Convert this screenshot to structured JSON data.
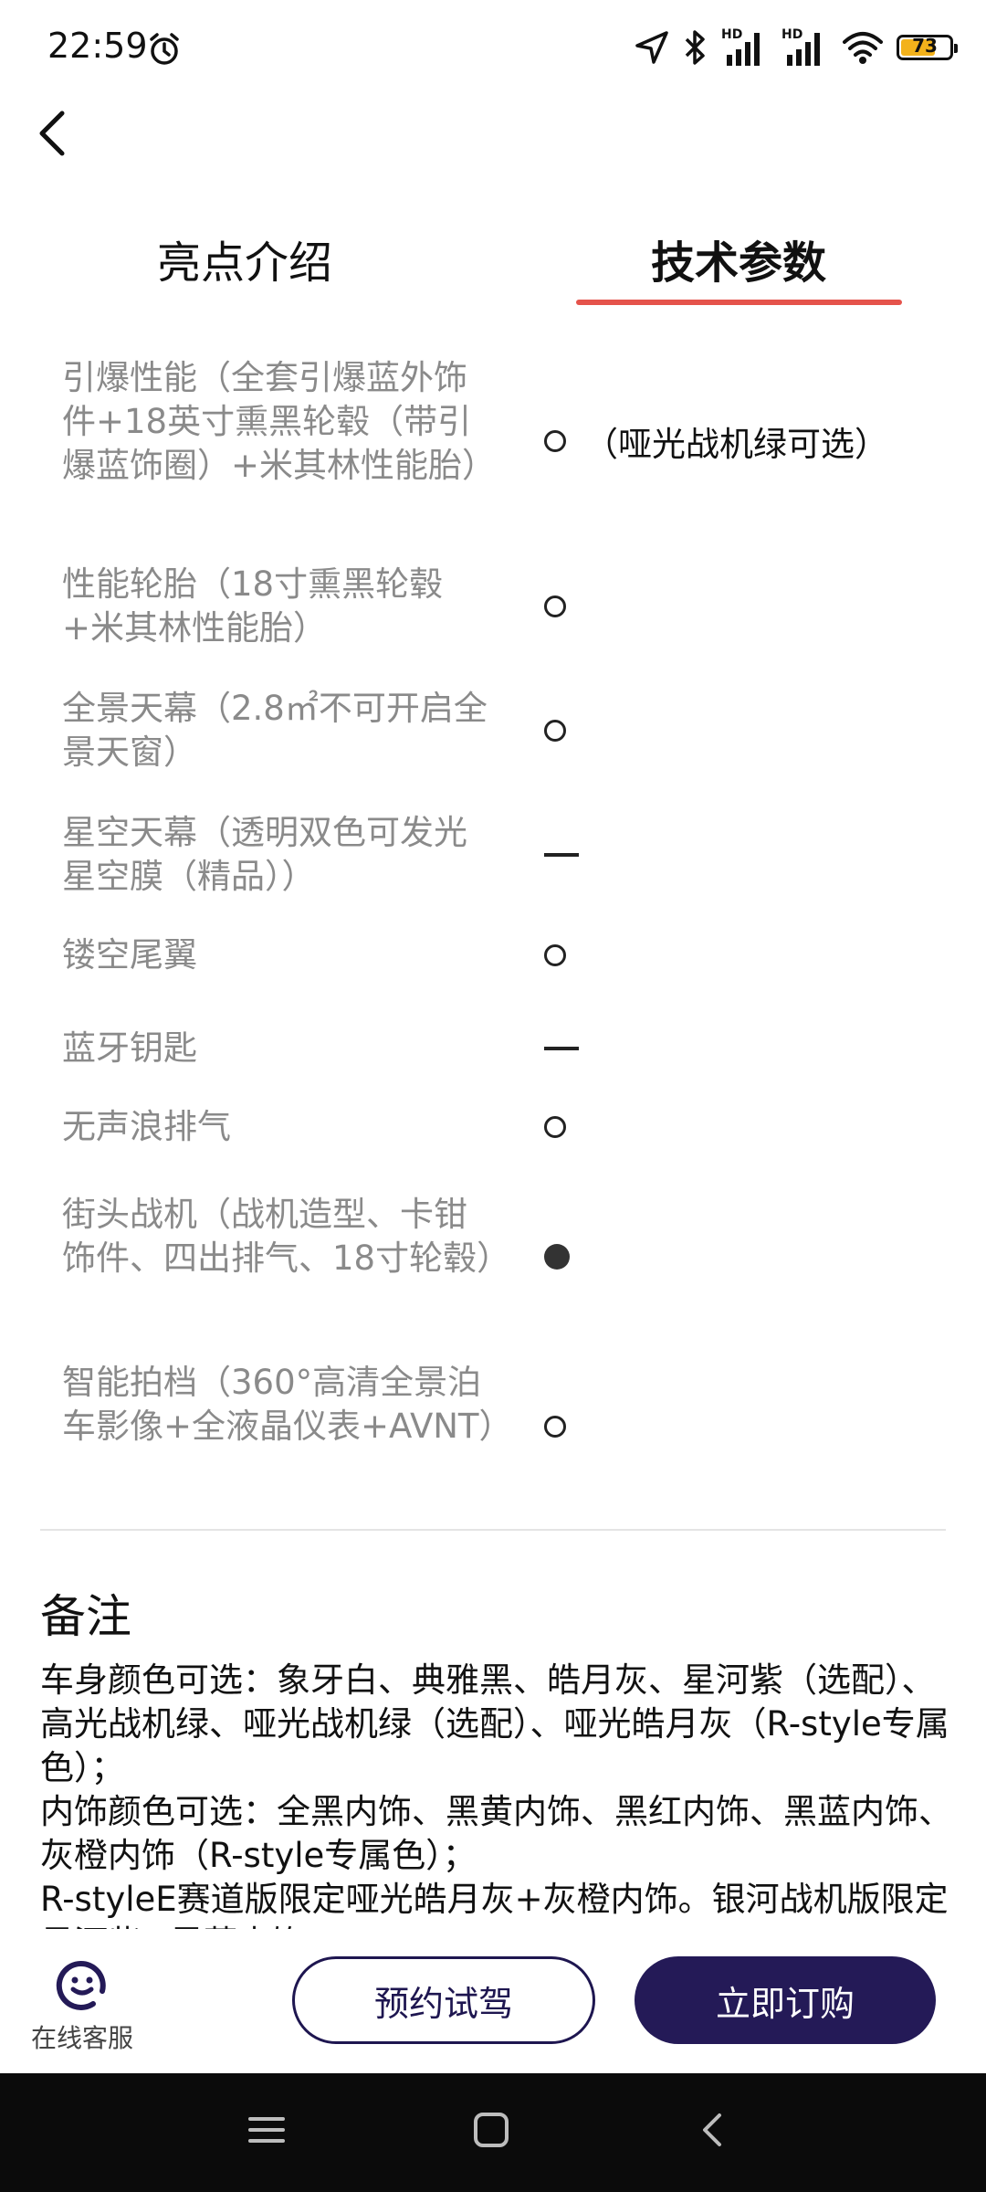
{
  "status_bar": {
    "time": "22:59",
    "icons": [
      "alarm-icon",
      "location-icon",
      "bluetooth-icon",
      "signal-hd-icon",
      "signal-hd-icon",
      "wifi-icon",
      "battery-icon"
    ],
    "hd_label": "HD",
    "battery_level": "73",
    "battery_color": "#f3b21b"
  },
  "tabs": [
    {
      "label": "亮点介绍",
      "active": false
    },
    {
      "label": "技术参数",
      "active": true
    }
  ],
  "accent_color": "#e5534b",
  "specs": [
    {
      "label": "引爆性能（全套引爆蓝外饰件+18英寸熏黑轮毂（带引爆蓝饰圈）+米其林性能胎）",
      "mark": "optional",
      "value_text": "（哑光战机绿可选）"
    },
    {
      "label": "性能轮胎（18寸熏黑轮毂+米其林性能胎）",
      "mark": "optional",
      "value_text": ""
    },
    {
      "label": "全景天幕（2.8㎡不可开启全景天窗）",
      "mark": "optional",
      "value_text": ""
    },
    {
      "label": "星空天幕（透明双色可发光星空膜（精品））",
      "mark": "none",
      "value_text": ""
    },
    {
      "label": "镂空尾翼",
      "mark": "optional",
      "value_text": ""
    },
    {
      "label": "蓝牙钥匙",
      "mark": "none",
      "value_text": ""
    },
    {
      "label": "无声浪排气",
      "mark": "optional",
      "value_text": ""
    },
    {
      "label": "街头战机（战机造型、卡钳饰件、四出排气、18寸轮毂）",
      "mark": "standard",
      "value_text": ""
    },
    {
      "label": "智能拍档（360°高清全景泊车影像+全液晶仪表+AVNT）",
      "mark": "optional",
      "value_text": ""
    }
  ],
  "remarks": {
    "title": "备注",
    "lines": [
      "车身颜色可选：象牙白、典雅黑、皓月灰、星河紫（选配）、高光战机绿、哑光战机绿（选配）、哑光皓月灰（R-style专属色）；",
      "内饰颜色可选：全黑内饰、黑黄内饰、黑红内饰、黑蓝内饰、灰橙内饰（R-style专属色）；",
      "R-styleE赛道版限定哑光皓月灰+灰橙内饰。银河战机版限定星河紫+黑蓝内饰。"
    ]
  },
  "bottom_bar": {
    "service_label": "在线客服",
    "test_drive_label": "预约试驾",
    "buy_label": "立即订购",
    "brand_color": "#241a57"
  },
  "nav_bar": {
    "icons": [
      "menu-icon",
      "home-icon",
      "back-icon"
    ]
  }
}
